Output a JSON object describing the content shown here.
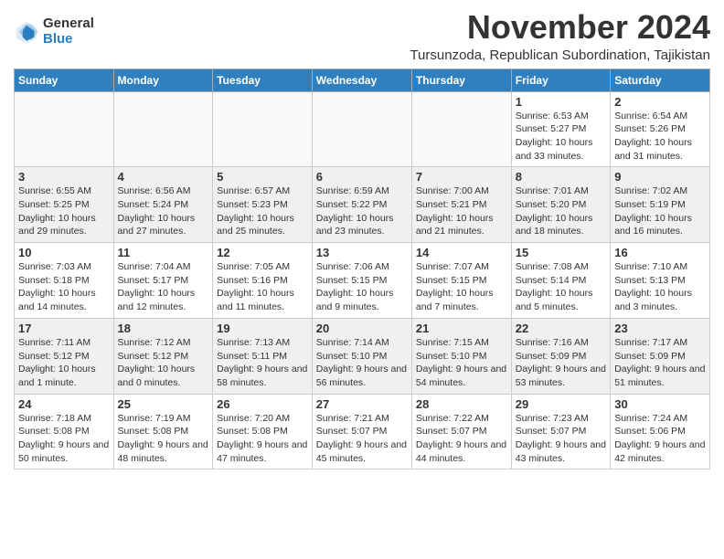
{
  "header": {
    "logo": {
      "general": "General",
      "blue": "Blue"
    },
    "title": "November 2024",
    "subtitle": "Tursunzoda, Republican Subordination, Tajikistan"
  },
  "days_of_week": [
    "Sunday",
    "Monday",
    "Tuesday",
    "Wednesday",
    "Thursday",
    "Friday",
    "Saturday"
  ],
  "weeks": [
    {
      "days": [
        {
          "num": "",
          "content": ""
        },
        {
          "num": "",
          "content": ""
        },
        {
          "num": "",
          "content": ""
        },
        {
          "num": "",
          "content": ""
        },
        {
          "num": "",
          "content": ""
        },
        {
          "num": "1",
          "content": "Sunrise: 6:53 AM\nSunset: 5:27 PM\nDaylight: 10 hours and 33 minutes."
        },
        {
          "num": "2",
          "content": "Sunrise: 6:54 AM\nSunset: 5:26 PM\nDaylight: 10 hours and 31 minutes."
        }
      ]
    },
    {
      "days": [
        {
          "num": "3",
          "content": "Sunrise: 6:55 AM\nSunset: 5:25 PM\nDaylight: 10 hours and 29 minutes."
        },
        {
          "num": "4",
          "content": "Sunrise: 6:56 AM\nSunset: 5:24 PM\nDaylight: 10 hours and 27 minutes."
        },
        {
          "num": "5",
          "content": "Sunrise: 6:57 AM\nSunset: 5:23 PM\nDaylight: 10 hours and 25 minutes."
        },
        {
          "num": "6",
          "content": "Sunrise: 6:59 AM\nSunset: 5:22 PM\nDaylight: 10 hours and 23 minutes."
        },
        {
          "num": "7",
          "content": "Sunrise: 7:00 AM\nSunset: 5:21 PM\nDaylight: 10 hours and 21 minutes."
        },
        {
          "num": "8",
          "content": "Sunrise: 7:01 AM\nSunset: 5:20 PM\nDaylight: 10 hours and 18 minutes."
        },
        {
          "num": "9",
          "content": "Sunrise: 7:02 AM\nSunset: 5:19 PM\nDaylight: 10 hours and 16 minutes."
        }
      ]
    },
    {
      "days": [
        {
          "num": "10",
          "content": "Sunrise: 7:03 AM\nSunset: 5:18 PM\nDaylight: 10 hours and 14 minutes."
        },
        {
          "num": "11",
          "content": "Sunrise: 7:04 AM\nSunset: 5:17 PM\nDaylight: 10 hours and 12 minutes."
        },
        {
          "num": "12",
          "content": "Sunrise: 7:05 AM\nSunset: 5:16 PM\nDaylight: 10 hours and 11 minutes."
        },
        {
          "num": "13",
          "content": "Sunrise: 7:06 AM\nSunset: 5:15 PM\nDaylight: 10 hours and 9 minutes."
        },
        {
          "num": "14",
          "content": "Sunrise: 7:07 AM\nSunset: 5:15 PM\nDaylight: 10 hours and 7 minutes."
        },
        {
          "num": "15",
          "content": "Sunrise: 7:08 AM\nSunset: 5:14 PM\nDaylight: 10 hours and 5 minutes."
        },
        {
          "num": "16",
          "content": "Sunrise: 7:10 AM\nSunset: 5:13 PM\nDaylight: 10 hours and 3 minutes."
        }
      ]
    },
    {
      "days": [
        {
          "num": "17",
          "content": "Sunrise: 7:11 AM\nSunset: 5:12 PM\nDaylight: 10 hours and 1 minute."
        },
        {
          "num": "18",
          "content": "Sunrise: 7:12 AM\nSunset: 5:12 PM\nDaylight: 10 hours and 0 minutes."
        },
        {
          "num": "19",
          "content": "Sunrise: 7:13 AM\nSunset: 5:11 PM\nDaylight: 9 hours and 58 minutes."
        },
        {
          "num": "20",
          "content": "Sunrise: 7:14 AM\nSunset: 5:10 PM\nDaylight: 9 hours and 56 minutes."
        },
        {
          "num": "21",
          "content": "Sunrise: 7:15 AM\nSunset: 5:10 PM\nDaylight: 9 hours and 54 minutes."
        },
        {
          "num": "22",
          "content": "Sunrise: 7:16 AM\nSunset: 5:09 PM\nDaylight: 9 hours and 53 minutes."
        },
        {
          "num": "23",
          "content": "Sunrise: 7:17 AM\nSunset: 5:09 PM\nDaylight: 9 hours and 51 minutes."
        }
      ]
    },
    {
      "days": [
        {
          "num": "24",
          "content": "Sunrise: 7:18 AM\nSunset: 5:08 PM\nDaylight: 9 hours and 50 minutes."
        },
        {
          "num": "25",
          "content": "Sunrise: 7:19 AM\nSunset: 5:08 PM\nDaylight: 9 hours and 48 minutes."
        },
        {
          "num": "26",
          "content": "Sunrise: 7:20 AM\nSunset: 5:08 PM\nDaylight: 9 hours and 47 minutes."
        },
        {
          "num": "27",
          "content": "Sunrise: 7:21 AM\nSunset: 5:07 PM\nDaylight: 9 hours and 45 minutes."
        },
        {
          "num": "28",
          "content": "Sunrise: 7:22 AM\nSunset: 5:07 PM\nDaylight: 9 hours and 44 minutes."
        },
        {
          "num": "29",
          "content": "Sunrise: 7:23 AM\nSunset: 5:07 PM\nDaylight: 9 hours and 43 minutes."
        },
        {
          "num": "30",
          "content": "Sunrise: 7:24 AM\nSunset: 5:06 PM\nDaylight: 9 hours and 42 minutes."
        }
      ]
    }
  ]
}
